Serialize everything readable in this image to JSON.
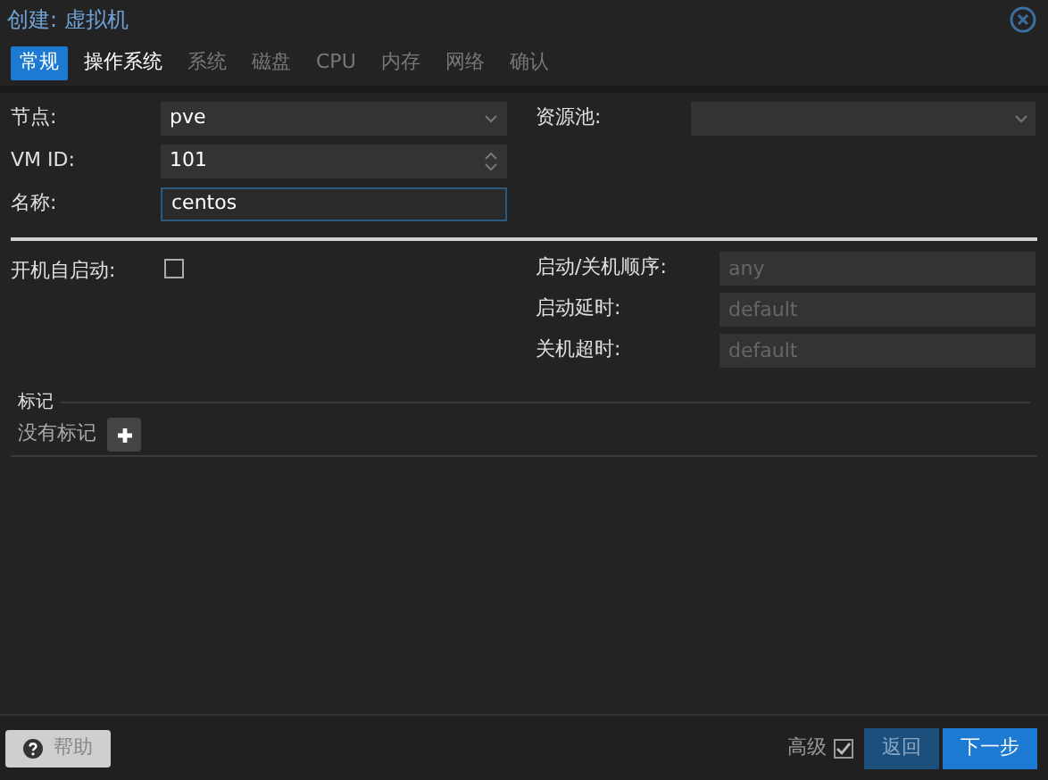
{
  "window": {
    "title": "创建: 虚拟机"
  },
  "tabs": [
    {
      "label": "常规",
      "selected": true,
      "disabled": false
    },
    {
      "label": "操作系统",
      "selected": false,
      "disabled": false
    },
    {
      "label": "系统",
      "selected": false,
      "disabled": true
    },
    {
      "label": "磁盘",
      "selected": false,
      "disabled": true
    },
    {
      "label": "CPU",
      "selected": false,
      "disabled": true
    },
    {
      "label": "内存",
      "selected": false,
      "disabled": true
    },
    {
      "label": "网络",
      "selected": false,
      "disabled": true
    },
    {
      "label": "确认",
      "selected": false,
      "disabled": true
    }
  ],
  "fields": [
    {
      "kind": "select",
      "label": "节点:",
      "value": "pve",
      "focused": false
    },
    {
      "kind": "spinner",
      "label": "VM ID:",
      "value": "101",
      "focused": false
    },
    {
      "kind": "text",
      "label": "名称:",
      "value": "centos",
      "focused": true
    }
  ],
  "resource_pool": {
    "label": "资源池:"
  },
  "start_at_boot": {
    "label": "开机自启动:",
    "checked": false
  },
  "startup_fields": [
    {
      "label": "启动/关机顺序:",
      "placeholder": "any"
    },
    {
      "label": "启动延时:",
      "placeholder": "default"
    },
    {
      "label": "关机超时:",
      "placeholder": "default"
    }
  ],
  "tags": {
    "legend": "标记",
    "empty_text": "没有标记"
  },
  "footer": {
    "help": "帮助",
    "advanced": {
      "label": "高级",
      "checked": true
    },
    "buttons": [
      {
        "label": "返回",
        "disabled": true
      },
      {
        "label": "下一步",
        "disabled": false
      }
    ]
  }
}
